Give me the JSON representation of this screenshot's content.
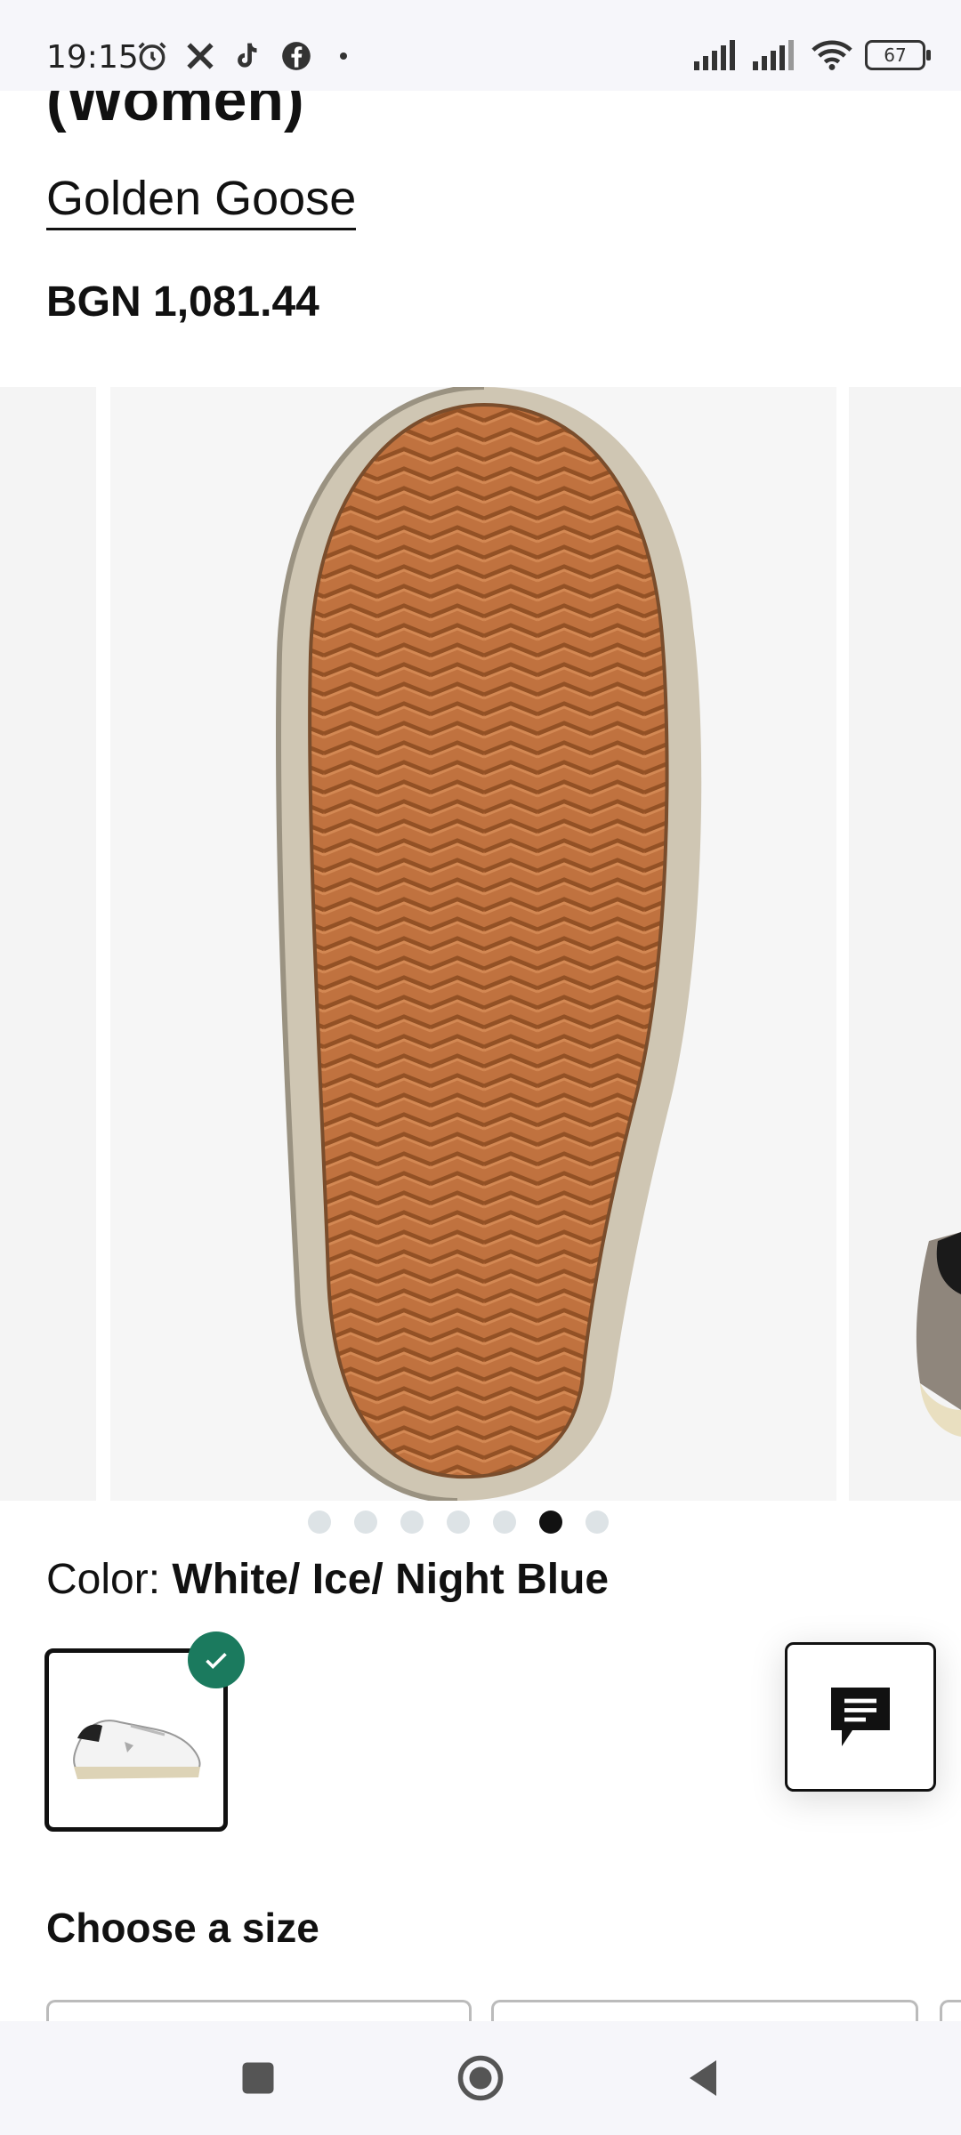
{
  "status_bar": {
    "time": "19:15",
    "battery": "67",
    "left_icons": [
      "alarm-icon",
      "x-icon",
      "tiktok-icon",
      "facebook-icon"
    ],
    "right_icons": [
      "signal-icon",
      "signal-icon",
      "wifi-icon",
      "battery-icon"
    ]
  },
  "product": {
    "title_partial": "(Women)",
    "brand": "Golden Goose",
    "price": "BGN 1,081.44"
  },
  "carousel": {
    "slide_count": 7,
    "active_index": 5
  },
  "color": {
    "label": "Color:",
    "value": "White/ Ice/ Night Blue"
  },
  "size": {
    "heading": "Choose a size"
  },
  "nav": {
    "icons": [
      "recent-apps-icon",
      "home-icon",
      "back-icon"
    ]
  },
  "theme": {
    "accent_check": "#1b7a5e",
    "sole_color": "#c0723f"
  }
}
